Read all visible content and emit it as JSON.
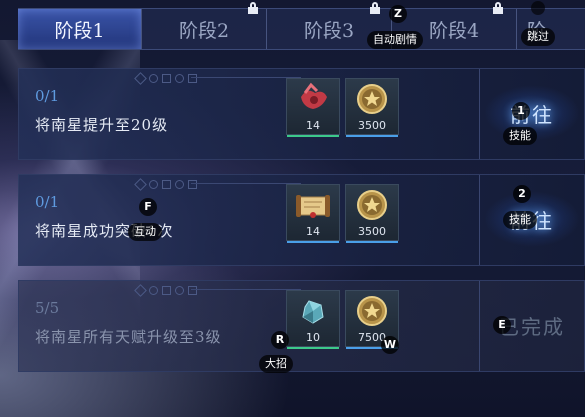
{
  "tabs": [
    {
      "label": "阶段1",
      "active": true,
      "locked": false
    },
    {
      "label": "阶段2",
      "active": false,
      "locked": true
    },
    {
      "label": "阶段3",
      "active": false,
      "locked": true
    },
    {
      "label": "阶段4",
      "active": false,
      "locked": true
    },
    {
      "label": "阶",
      "active": false,
      "locked": false
    }
  ],
  "overlay": {
    "auto_story": "自动剧情",
    "skip": "跳过",
    "key_z": "Z",
    "skill1_key": "1",
    "skill1_label": "技能",
    "skill2_key": "2",
    "skill2_label": "技能",
    "f_key": "F",
    "f_label": "互动",
    "r_key": "R",
    "r_label": "大招",
    "e_key": "E",
    "w_key": "W"
  },
  "tasks": [
    {
      "progress": "0/1",
      "desc": "将南星提升至20级",
      "button": "前往",
      "rewards": [
        {
          "icon": "red-cloth-material-icon",
          "count": "14",
          "bar": "#3cc98a"
        },
        {
          "icon": "gold-star-coin-icon",
          "count": "3500",
          "bar": "#4a9fe8"
        }
      ]
    },
    {
      "progress": "0/1",
      "desc": "将南星成功突破1次",
      "button": "前往",
      "rewards": [
        {
          "icon": "scroll-material-icon",
          "count": "14",
          "bar": "#4a9fe8"
        },
        {
          "icon": "gold-star-coin-icon",
          "count": "3500",
          "bar": "#4a9fe8"
        }
      ]
    },
    {
      "progress": "5/5",
      "desc": "将南星所有天赋升级至3级",
      "button": "已完成",
      "rewards": [
        {
          "icon": "blue-crystal-icon",
          "count": "10",
          "bar": "#3cc98a"
        },
        {
          "icon": "gold-star-coin-icon",
          "count": "7500",
          "bar": "#4a9fe8"
        }
      ]
    }
  ]
}
